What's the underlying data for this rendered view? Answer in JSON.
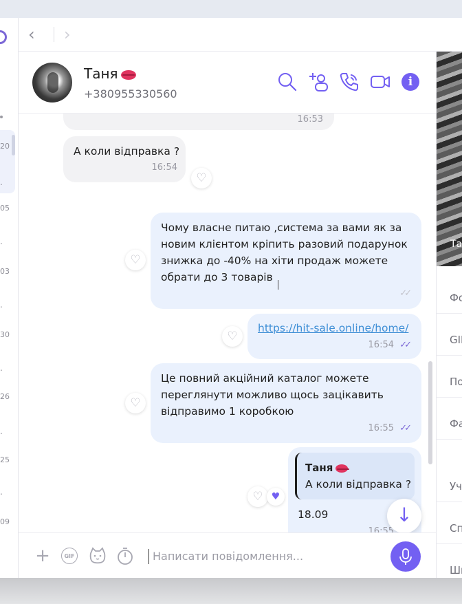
{
  "nav": {
    "back_glyph": "‹",
    "forward_glyph": "›"
  },
  "contact": {
    "name": "Таня",
    "phone": "+380955330560",
    "name_emoji": "kiss-mark-icon"
  },
  "left_list": {
    "times": [
      "20",
      "05",
      "03",
      "30",
      "26",
      "25",
      "09"
    ],
    "ellipsis": "."
  },
  "right_panel": {
    "image_label": "Таня",
    "items": [
      "Фото",
      "GIF",
      "Посилання",
      "Файли",
      "Учасники",
      "Спільні",
      "Шпалери"
    ]
  },
  "messages": [
    {
      "direction": "in",
      "text": "",
      "time": "16:53"
    },
    {
      "direction": "in",
      "text": "А коли відправка ?",
      "time": "16:54"
    },
    {
      "direction": "out",
      "lines": [
        "Чому власне питаю ,система за вами як за",
        "новим клієнтом кріпить разовий подарунок",
        "знижка до -40% на хіти продаж можете",
        "обрати до 3 товарів"
      ],
      "time": "",
      "status": "sending"
    },
    {
      "direction": "out",
      "link": "https://hit-sale.online/home/",
      "time": "16:54",
      "status": "read"
    },
    {
      "direction": "out",
      "lines": [
        "Це повний акційний каталог можете",
        "переглянути можливо щось зацікавить",
        "відправимо 1 коробкою"
      ],
      "time": "16:55",
      "status": "read"
    },
    {
      "direction": "out",
      "quote_author": "Таня",
      "quote_text": "А коли відправка ?",
      "text": "18.09",
      "time": "16:55",
      "liked": true
    }
  ],
  "composer": {
    "placeholder": "Написати повідомлення..."
  },
  "colors": {
    "accent": "#7360f2",
    "incoming": "#f2f2f4",
    "outgoing": "#eaf1fd",
    "link": "#3f8fd6"
  }
}
